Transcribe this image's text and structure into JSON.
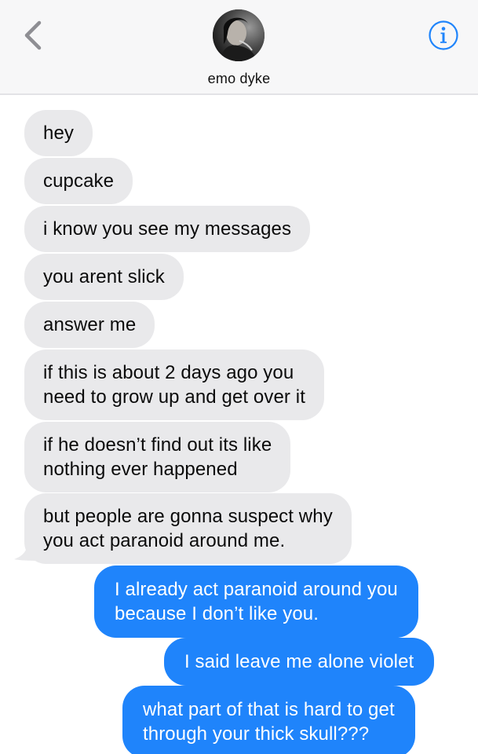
{
  "header": {
    "contact_name": "emo dyke",
    "back_icon": "chevron-left-icon",
    "info_icon": "info-icon",
    "accent_color": "#1f84fb"
  },
  "messages": [
    {
      "direction": "incoming",
      "text": "hey"
    },
    {
      "direction": "incoming",
      "text": "cupcake"
    },
    {
      "direction": "incoming",
      "text": "i know you see my messages"
    },
    {
      "direction": "incoming",
      "text": "you arent slick"
    },
    {
      "direction": "incoming",
      "text": "answer me"
    },
    {
      "direction": "incoming",
      "lines": [
        "if this is about 2 days ago you",
        "need to grow up and get over it"
      ]
    },
    {
      "direction": "incoming",
      "lines": [
        "if he doesn’t find out its like",
        "nothing ever happened"
      ]
    },
    {
      "direction": "incoming",
      "lines": [
        "but people are gonna suspect why",
        "you act paranoid around me."
      ]
    },
    {
      "direction": "outgoing",
      "lines": [
        "I already act paranoid around you",
        "because I don’t like you."
      ]
    },
    {
      "direction": "outgoing",
      "text": "I said leave me alone violet"
    },
    {
      "direction": "outgoing",
      "lines": [
        "what part of that is hard to get",
        "through your thick skull???"
      ]
    }
  ],
  "colors": {
    "incoming_bubble": "#e9e9eb",
    "outgoing_bubble": "#1f84fb",
    "header_background": "#f7f7f8"
  }
}
